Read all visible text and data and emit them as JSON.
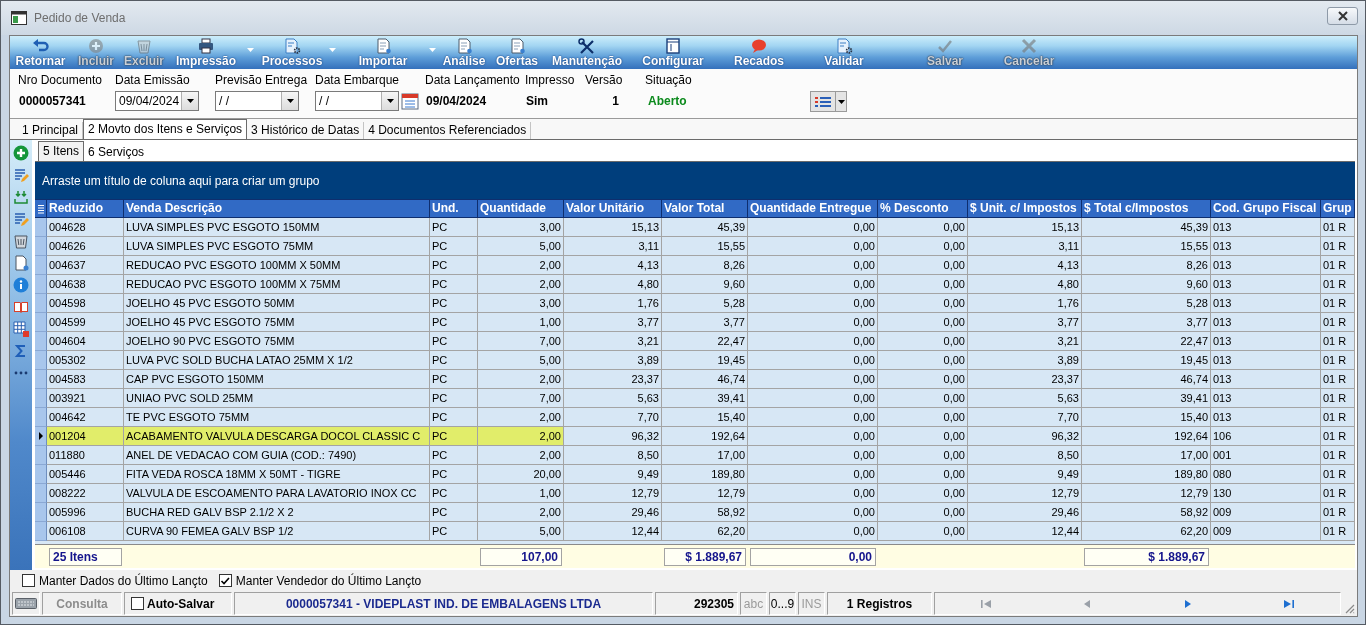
{
  "window": {
    "title": "Pedido de Venda"
  },
  "toolbar": [
    {
      "label": "Retornar",
      "disabled": false,
      "dropdown": false
    },
    {
      "label": "Incluir",
      "disabled": true,
      "dropdown": false
    },
    {
      "label": "Excluir",
      "disabled": true,
      "dropdown": false
    },
    {
      "label": "Impressão",
      "disabled": false,
      "dropdown": true
    },
    {
      "label": "Processos",
      "disabled": false,
      "dropdown": true
    },
    {
      "label": "Importar",
      "disabled": false,
      "dropdown": true
    },
    {
      "label": "Análise",
      "disabled": false,
      "dropdown": false
    },
    {
      "label": "Ofertas",
      "disabled": false,
      "dropdown": false
    },
    {
      "label": "Manutenção",
      "disabled": false,
      "dropdown": false
    },
    {
      "label": "Configurar",
      "disabled": false,
      "dropdown": false
    },
    {
      "label": "Recados",
      "disabled": false,
      "dropdown": false
    },
    {
      "label": "Validar",
      "disabled": false,
      "dropdown": false
    },
    {
      "label": "Salvar",
      "disabled": true,
      "dropdown": false
    },
    {
      "label": "Cancelar",
      "disabled": true,
      "dropdown": false
    }
  ],
  "header_fields": [
    {
      "label": "Nro Documento",
      "value": "0000057341",
      "kind": "value",
      "calendar_button": false
    },
    {
      "label": "Data Emissão",
      "value": "09/04/2024",
      "kind": "combo",
      "calendar_button": false
    },
    {
      "label": "Previsão Entrega",
      "value": "/ /",
      "kind": "combo",
      "calendar_button": false
    },
    {
      "label": "Data Embarque",
      "value": "/ /",
      "kind": "combo",
      "calendar_button": true
    },
    {
      "label": "Data Lançamento",
      "value": "09/04/2024",
      "kind": "value",
      "calendar_button": false
    },
    {
      "label": "Impresso",
      "value": "Sim",
      "kind": "value",
      "calendar_button": false
    },
    {
      "label": "Versão",
      "value": "1",
      "kind": "number",
      "calendar_button": false
    },
    {
      "label": "Situação",
      "value": "Aberto",
      "kind": "status",
      "calendar_button": false
    }
  ],
  "tabs": [
    {
      "label": "1 Principal",
      "selected": false
    },
    {
      "label": "2 Movto dos Itens e Serviços",
      "selected": true
    },
    {
      "label": "3 Histórico de Datas",
      "selected": false
    },
    {
      "label": "4 Documentos Referenciados",
      "selected": false
    }
  ],
  "subtabs": [
    {
      "label": "5 Itens",
      "selected": true
    },
    {
      "label": "6 Serviços",
      "selected": false
    }
  ],
  "grid": {
    "group_panel": "Arraste um título de coluna aqui para criar um grupo",
    "columns": [
      {
        "label": "Reduzido",
        "kind": "text",
        "total": "25 Itens"
      },
      {
        "label": "Venda Descrição",
        "kind": "text"
      },
      {
        "label": "Und.",
        "kind": "text"
      },
      {
        "label": "Quantidade",
        "kind": "number",
        "total": "107,00"
      },
      {
        "label": "Valor Unitário",
        "kind": "number"
      },
      {
        "label": "Valor Total",
        "kind": "number",
        "total": "$ 1.889,67"
      },
      {
        "label": "Quantidade Entregue",
        "kind": "number",
        "total": "0,00"
      },
      {
        "label": "% Desconto",
        "kind": "number"
      },
      {
        "label": "$ Unit. c/ Impostos",
        "kind": "number"
      },
      {
        "label": "$ Total c/Impostos",
        "kind": "number",
        "total": "$ 1.889,67"
      },
      {
        "label": "Cod. Grupo Fiscal",
        "kind": "text"
      },
      {
        "label": "Grup",
        "kind": "text"
      }
    ],
    "rows": [
      {
        "cells": [
          "004628",
          "LUVA SIMPLES PVC ESGOTO 150MM",
          "PC",
          "3,00",
          "15,13",
          "45,39",
          "0,00",
          "0,00",
          "15,13",
          "45,39",
          "013",
          "01 R"
        ],
        "selected": false
      },
      {
        "cells": [
          "004626",
          "LUVA SIMPLES PVC ESGOTO 75MM",
          "PC",
          "5,00",
          "3,11",
          "15,55",
          "0,00",
          "0,00",
          "3,11",
          "15,55",
          "013",
          "01 R"
        ],
        "selected": false
      },
      {
        "cells": [
          "004637",
          "REDUCAO PVC ESGOTO 100MM X 50MM",
          "PC",
          "2,00",
          "4,13",
          "8,26",
          "0,00",
          "0,00",
          "4,13",
          "8,26",
          "013",
          "01 R"
        ],
        "selected": false
      },
      {
        "cells": [
          "004638",
          "REDUCAO PVC ESGOTO 100MM X 75MM",
          "PC",
          "2,00",
          "4,80",
          "9,60",
          "0,00",
          "0,00",
          "4,80",
          "9,60",
          "013",
          "01 R"
        ],
        "selected": false
      },
      {
        "cells": [
          "004598",
          "JOELHO 45 PVC ESGOTO 50MM",
          "PC",
          "3,00",
          "1,76",
          "5,28",
          "0,00",
          "0,00",
          "1,76",
          "5,28",
          "013",
          "01 R"
        ],
        "selected": false
      },
      {
        "cells": [
          "004599",
          "JOELHO 45 PVC ESGOTO 75MM",
          "PC",
          "1,00",
          "3,77",
          "3,77",
          "0,00",
          "0,00",
          "3,77",
          "3,77",
          "013",
          "01 R"
        ],
        "selected": false
      },
      {
        "cells": [
          "004604",
          "JOELHO 90 PVC ESGOTO 75MM",
          "PC",
          "7,00",
          "3,21",
          "22,47",
          "0,00",
          "0,00",
          "3,21",
          "22,47",
          "013",
          "01 R"
        ],
        "selected": false
      },
      {
        "cells": [
          "005302",
          "LUVA PVC SOLD BUCHA LATAO 25MM X 1/2",
          "PC",
          "5,00",
          "3,89",
          "19,45",
          "0,00",
          "0,00",
          "3,89",
          "19,45",
          "013",
          "01 R"
        ],
        "selected": false
      },
      {
        "cells": [
          "004583",
          "CAP PVC ESGOTO 150MM",
          "PC",
          "2,00",
          "23,37",
          "46,74",
          "0,00",
          "0,00",
          "23,37",
          "46,74",
          "013",
          "01 R"
        ],
        "selected": false
      },
      {
        "cells": [
          "003921",
          "UNIAO PVC SOLD 25MM",
          "PC",
          "7,00",
          "5,63",
          "39,41",
          "0,00",
          "0,00",
          "5,63",
          "39,41",
          "013",
          "01 R"
        ],
        "selected": false
      },
      {
        "cells": [
          "004642",
          "TE PVC ESGOTO 75MM",
          "PC",
          "2,00",
          "7,70",
          "15,40",
          "0,00",
          "0,00",
          "7,70",
          "15,40",
          "013",
          "01 R"
        ],
        "selected": false
      },
      {
        "cells": [
          "001204",
          "ACABAMENTO VALVULA DESCARGA DOCOL CLASSIC C",
          "PC",
          "2,00",
          "96,32",
          "192,64",
          "0,00",
          "0,00",
          "96,32",
          "192,64",
          "106",
          "01 R"
        ],
        "selected": true
      },
      {
        "cells": [
          "011880",
          "ANEL DE VEDACAO COM GUIA (COD.: 7490)",
          "PC",
          "2,00",
          "8,50",
          "17,00",
          "0,00",
          "0,00",
          "8,50",
          "17,00",
          "001",
          "01 R"
        ],
        "selected": false
      },
      {
        "cells": [
          "005446",
          "FITA VEDA ROSCA 18MM X 50MT - TIGRE",
          "PC",
          "20,00",
          "9,49",
          "189,80",
          "0,00",
          "0,00",
          "9,49",
          "189,80",
          "080",
          "01 R"
        ],
        "selected": false
      },
      {
        "cells": [
          "008222",
          "VALVULA DE ESCOAMENTO PARA LAVATORIO INOX CC",
          "PC",
          "1,00",
          "12,79",
          "12,79",
          "0,00",
          "0,00",
          "12,79",
          "12,79",
          "130",
          "01 R"
        ],
        "selected": false
      },
      {
        "cells": [
          "005996",
          "BUCHA RED GALV BSP 2.1/2 X 2",
          "PC",
          "2,00",
          "29,46",
          "58,92",
          "0,00",
          "0,00",
          "29,46",
          "58,92",
          "009",
          "01 R"
        ],
        "selected": false
      },
      {
        "cells": [
          "006108",
          "CURVA 90 FEMEA GALV BSP 1/2",
          "PC",
          "5,00",
          "12,44",
          "62,20",
          "0,00",
          "0,00",
          "12,44",
          "62,20",
          "009",
          "01 R"
        ],
        "selected": false
      }
    ]
  },
  "options": [
    {
      "label": "Manter Dados do Último Lançto",
      "checked": false
    },
    {
      "label": "Manter Vendedor do Último Lançto",
      "checked": true
    }
  ],
  "status_bar": {
    "mode": "Consulta",
    "auto_save": {
      "label": "Auto-Salvar",
      "checked": false
    },
    "record": "0000057341 - VIDEPLAST IND. DE EMBALAGENS LTDA",
    "code": "292305",
    "indicators": [
      {
        "label": "abc",
        "on": false
      },
      {
        "label": "0...9",
        "on": true
      },
      {
        "label": "INS",
        "on": false
      }
    ],
    "count": "1 Registros",
    "navigation": [
      {
        "kind": "first",
        "disabled": true
      },
      {
        "kind": "previous",
        "disabled": true
      },
      {
        "kind": "next",
        "disabled": false
      },
      {
        "kind": "last",
        "disabled": false
      }
    ]
  }
}
